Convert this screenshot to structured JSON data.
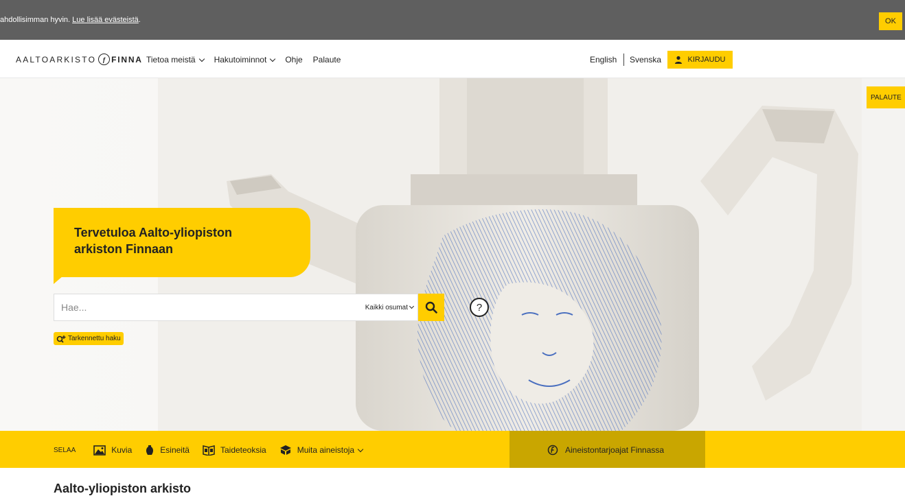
{
  "cookie": {
    "text": "ahdollisimman hyvin.",
    "link": "Lue lisää evästeistä",
    "trailing": ".",
    "ok_label": "OK"
  },
  "header": {
    "logo_left": "AALTOARKISTO",
    "logo_right": "FINNA",
    "nav": [
      {
        "label": "Tietoa meistä",
        "dropdown": true
      },
      {
        "label": "Hakutoiminnot",
        "dropdown": true
      },
      {
        "label": "Ohje",
        "dropdown": false
      },
      {
        "label": "Palaute",
        "dropdown": false
      }
    ],
    "lang_english": "English",
    "lang_swedish": "Svenska",
    "login_label": "KIRJAUDU"
  },
  "feedback_tab": "PALAUTE",
  "hero": {
    "welcome": "Tervetuloa Aalto-yliopiston arkiston Finnaan",
    "search_placeholder": "Hae...",
    "search_scope": "Kaikki osumat",
    "advanced_search": "Tarkennettu haku",
    "help_glyph": "?"
  },
  "browse": {
    "label": "SELAA",
    "items": [
      {
        "label": "Kuvia",
        "icon": "image-icon"
      },
      {
        "label": "Esineitä",
        "icon": "vase-icon"
      },
      {
        "label": "Taideteoksia",
        "icon": "art-book-icon"
      },
      {
        "label": "Muita aineistoja",
        "icon": "box-icon"
      }
    ],
    "providers": "Aineistontarjoajat Finnassa"
  },
  "section_title": "Aalto-yliopiston arkisto",
  "colors": {
    "accent": "#ffcd00",
    "accent_dark": "#c9a600",
    "cookie_bg": "#5f5f5f",
    "glaze_blue": "#4a6fbf"
  }
}
